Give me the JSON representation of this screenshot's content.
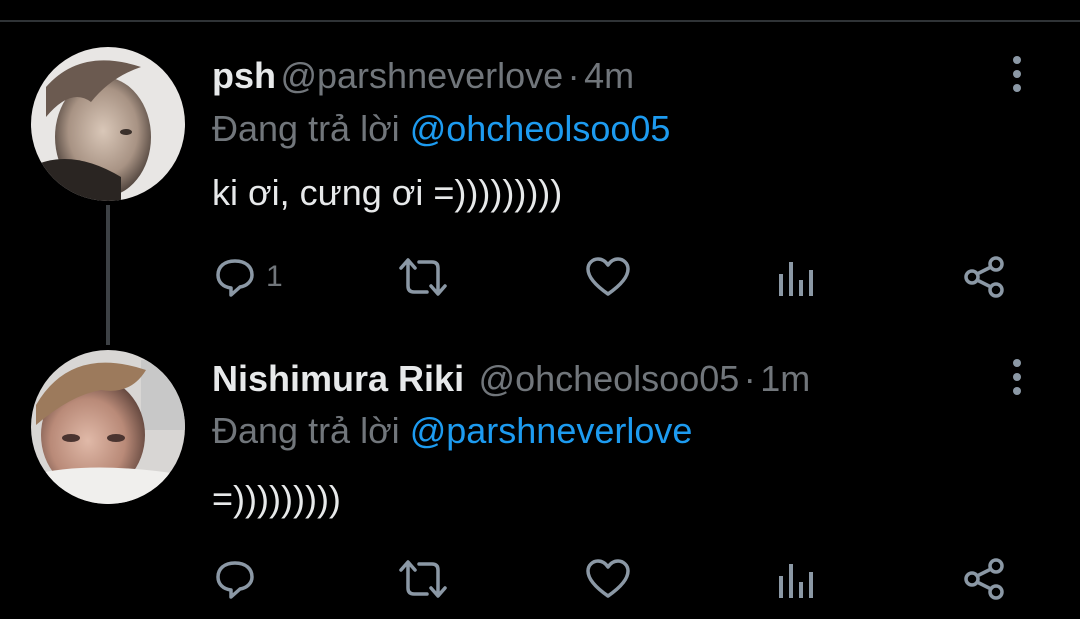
{
  "tweets": [
    {
      "display_name": "psh",
      "handle": "@parshneverlove",
      "separator": "·",
      "time": "4m",
      "reply_prefix": "Đang trả lời",
      "reply_to": "@ohcheolsoo05",
      "text": "ki ơi, cưng ơi =)))))))))",
      "reply_count": "1"
    },
    {
      "display_name": "Nishimura Riki",
      "handle": "@ohcheolsoo05",
      "separator": "·",
      "time": "1m",
      "reply_prefix": "Đang trả lời",
      "reply_to": "@parshneverlove",
      "text": "=)))))))))",
      "reply_count": ""
    }
  ],
  "icons": {
    "reply": "speech-bubble-icon",
    "retweet": "retweet-icon",
    "like": "heart-icon",
    "analytics": "bar-chart-icon",
    "share": "share-icon",
    "more": "vertical-dots-icon"
  },
  "colors": {
    "background": "#000000",
    "text": "#e7e9ea",
    "muted": "#71767b",
    "mention": "#1d9bf0",
    "icon": "#8b98a5"
  }
}
